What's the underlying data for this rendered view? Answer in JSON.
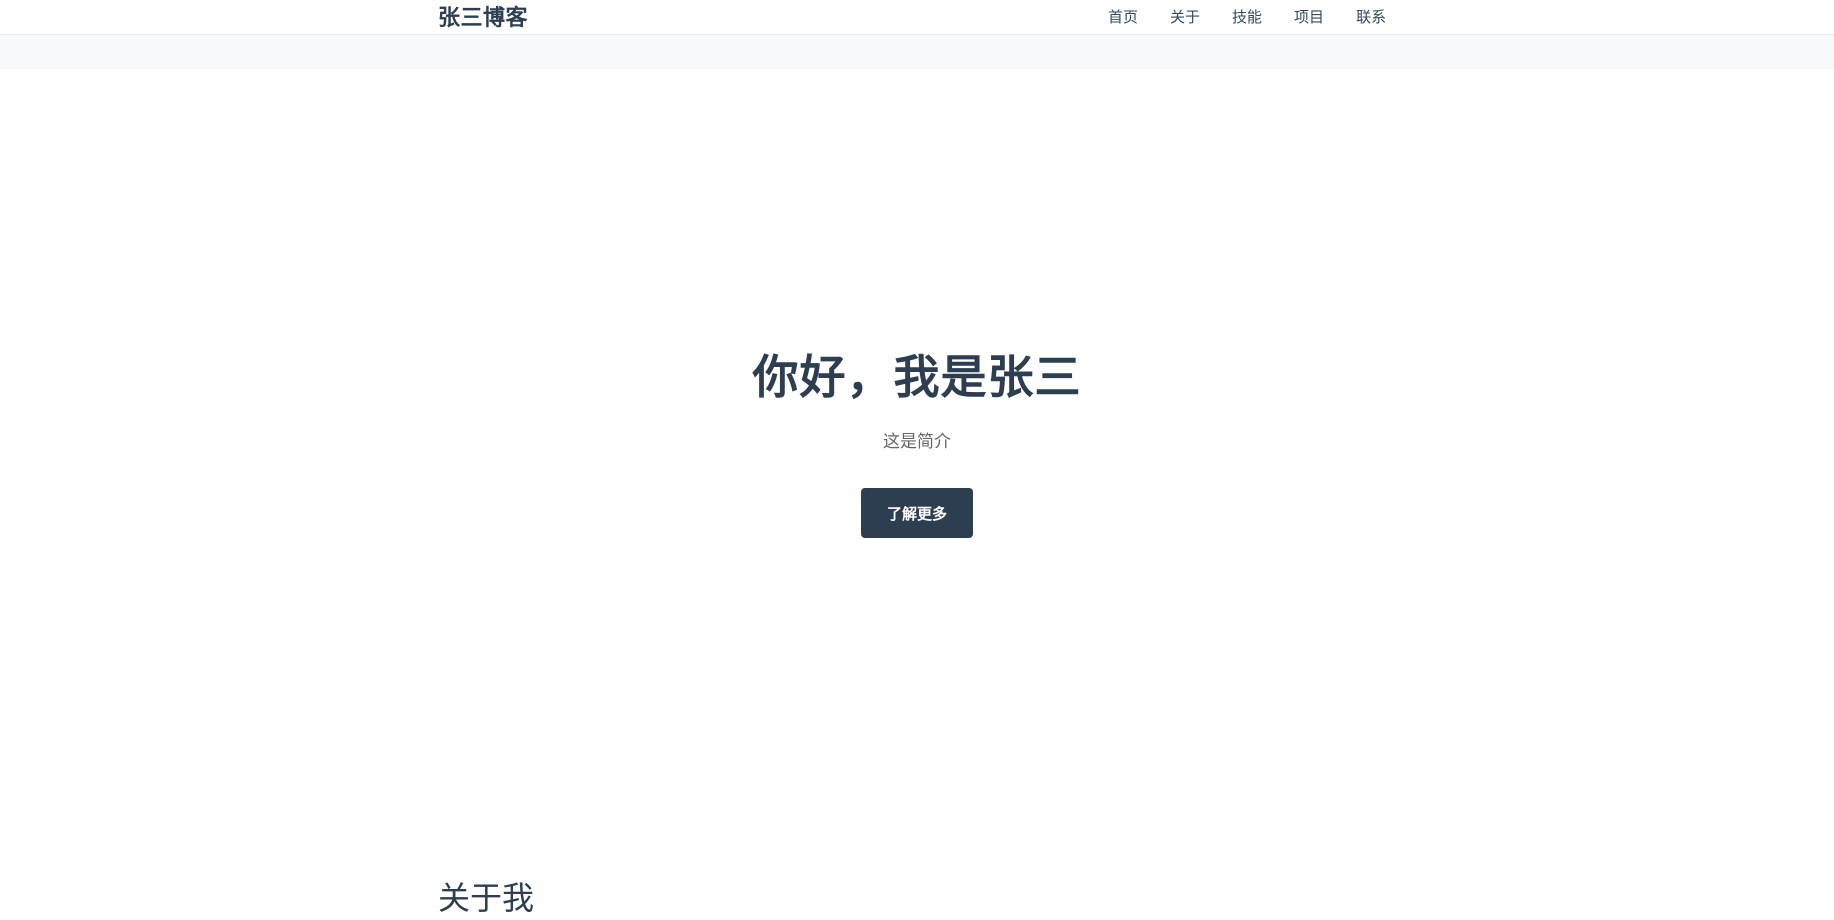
{
  "header": {
    "brand": "张三博客",
    "nav": [
      "首页",
      "关于",
      "技能",
      "项目",
      "联系"
    ]
  },
  "hero": {
    "title": "你好，我是张三",
    "subtitle": "这是简介",
    "button_label": "了解更多"
  },
  "about": {
    "title": "关于我"
  },
  "colors": {
    "primary": "#2c3e50",
    "text_muted": "#666666",
    "subbar_bg": "#f8f9fa"
  }
}
